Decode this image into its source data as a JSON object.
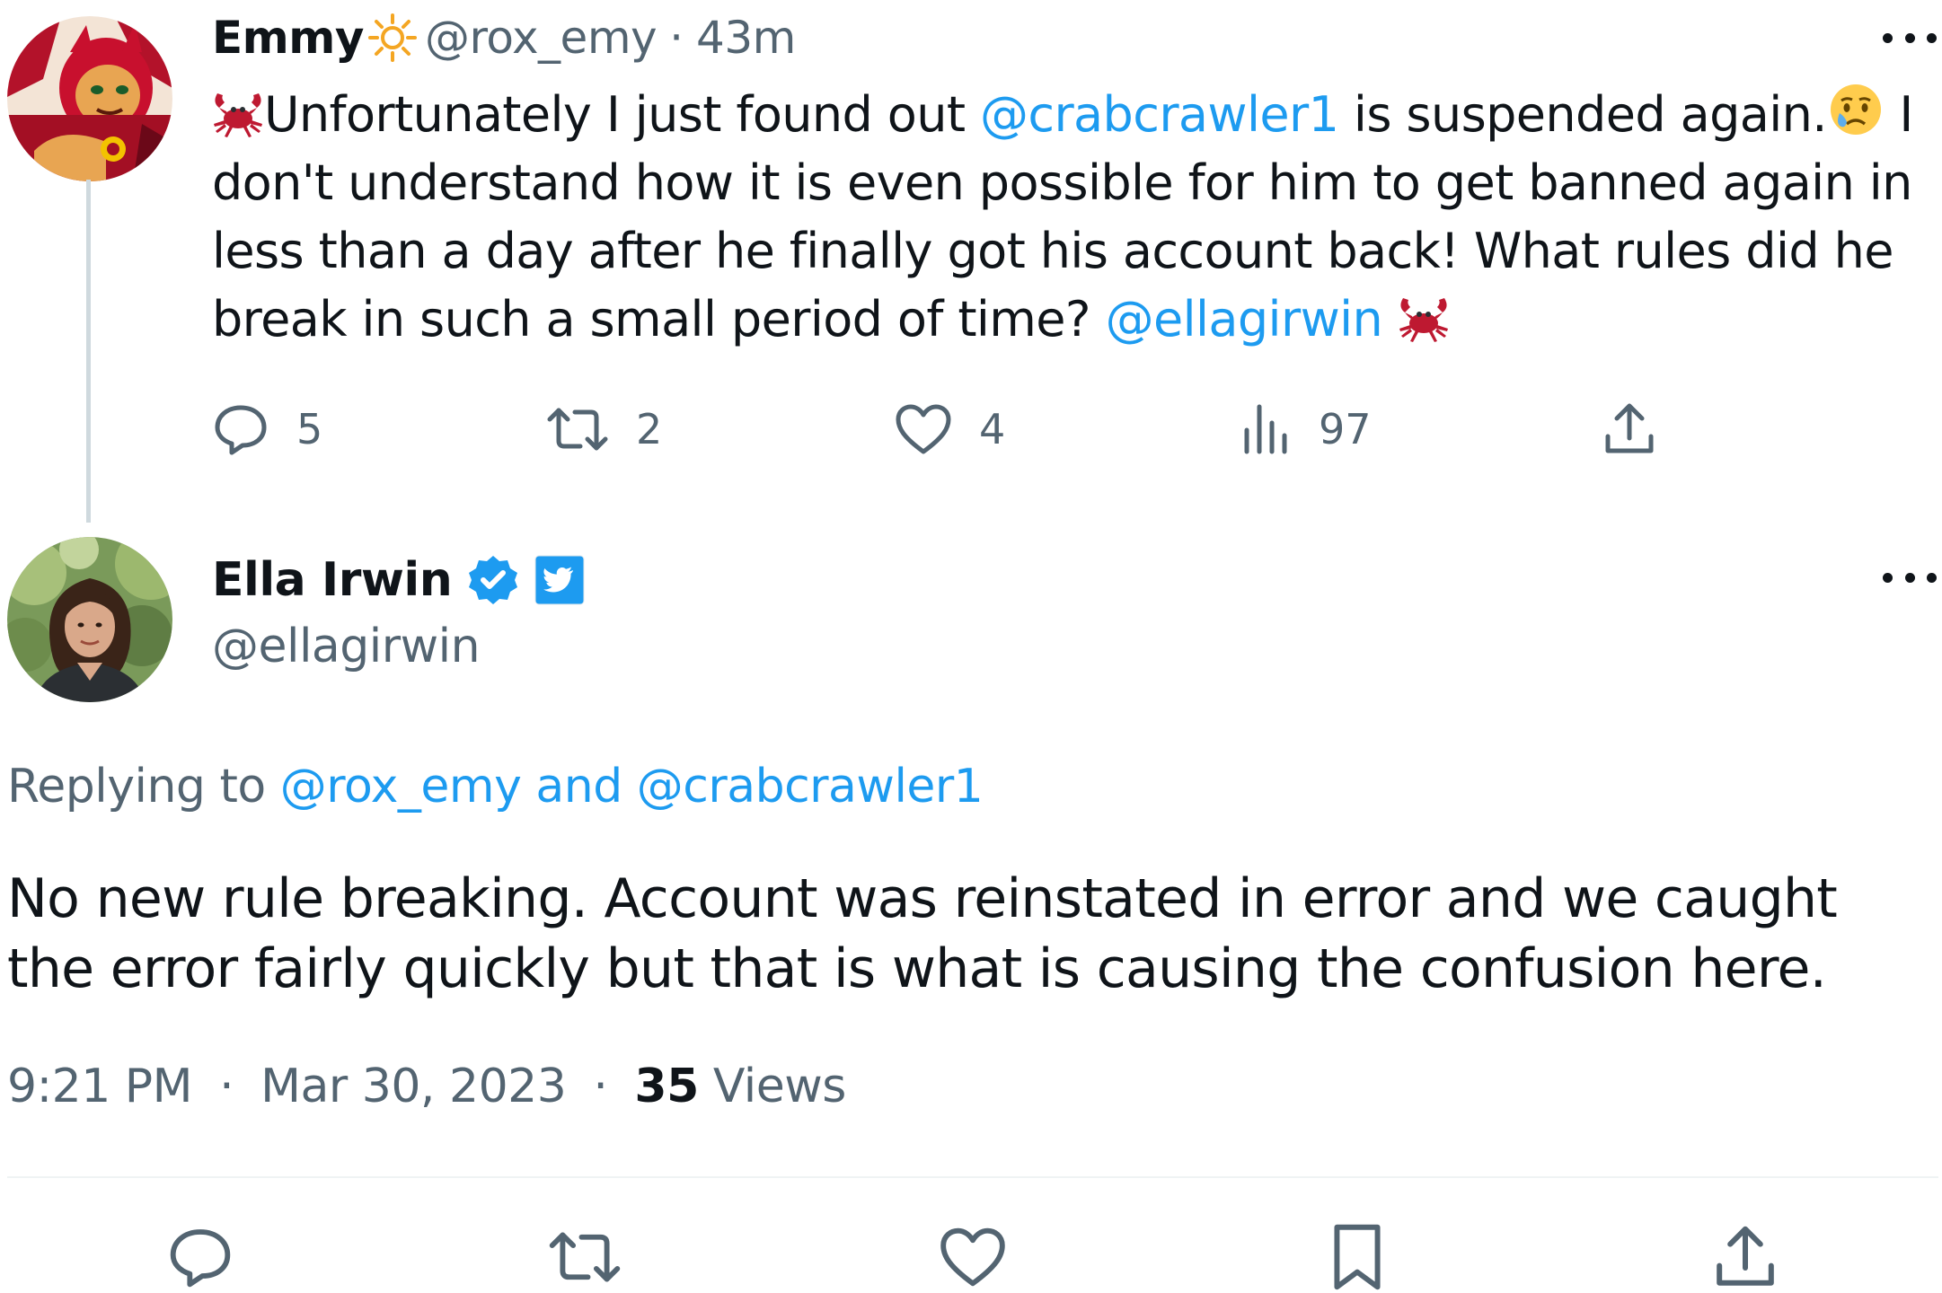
{
  "parent_tweet": {
    "display_name": "Emmy",
    "handle": "@rox_emy",
    "separator": "·",
    "time_ago": "43m",
    "text_parts": {
      "p1": "Unfortunately I just found out ",
      "mention1": "@crabcrawler1",
      "p2": " is suspended again.",
      "p3": " I don't understand how it is even possible for him to get banned again in less than a day after he finally got his account back!  What rules did he break in such a small period of time? ",
      "mention2": "@ellagirwin"
    },
    "stats": {
      "replies": "5",
      "retweets": "2",
      "likes": "4",
      "views": "97"
    }
  },
  "main_tweet": {
    "display_name": "Ella Irwin",
    "handle": "@ellagirwin",
    "replying_label": "Replying to ",
    "replying_to": "@rox_emy and @crabcrawler1",
    "text": "No new rule breaking. Account was reinstated in error and we caught the error fairly quickly but that is what is causing the confusion here.",
    "time": "9:21 PM",
    "separator": "·",
    "date": "Mar 30, 2023",
    "views_count": "35",
    "views_label": " Views"
  },
  "icons": {
    "reply": "reply-icon",
    "retweet": "retweet-icon",
    "like": "heart-icon",
    "views": "views-icon",
    "share": "share-icon",
    "bookmark": "bookmark-icon",
    "more": "more-icon",
    "verified": "verified-badge-icon",
    "affiliate": "twitter-affiliate-icon",
    "sun": "sun-emoji-icon",
    "crab": "crab-emoji-icon",
    "crying": "crying-face-emoji-icon"
  },
  "colors": {
    "accent": "#1d9bf0",
    "text": "#0f1419",
    "secondary": "#536471",
    "thread_line": "#cfd9de",
    "divider": "#eff3f4"
  }
}
